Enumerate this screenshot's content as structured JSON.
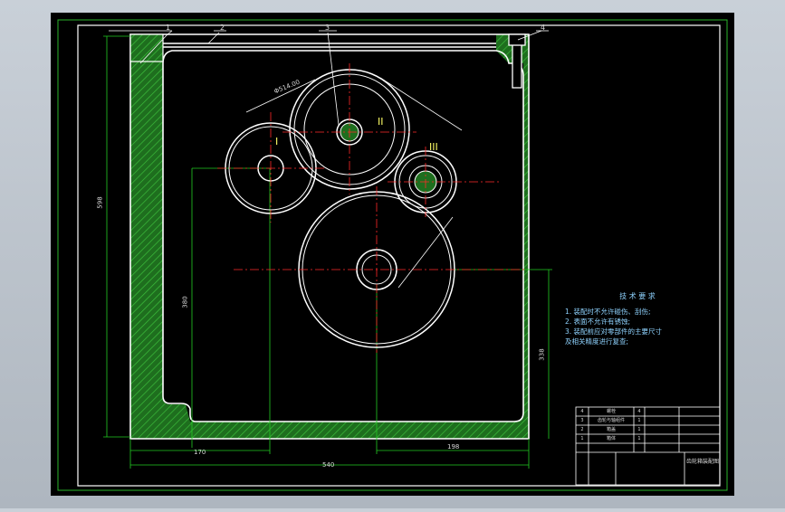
{
  "colors": {
    "background": "#000000",
    "frame": "#2ab52a",
    "outline": "#ffffff",
    "centerline": "#ff2a2a",
    "dimension": "#22cc22",
    "hatch": "#2fa32f",
    "text": "#d8d8d8",
    "note_text": "#8fd3ff",
    "roman_text": "#ffff66",
    "screen": "#c0c7cf"
  },
  "balloons": [
    "1",
    "2",
    "3",
    "4"
  ],
  "gear_labels": [
    "I",
    "II",
    "III"
  ],
  "dimensions": {
    "overall_height": "598",
    "shaft_height": "380",
    "right_height": "338",
    "left_offset": "170",
    "right_offset": "198",
    "overall_width": "540",
    "gear_dia": "Φ514.00"
  },
  "notes": {
    "title": "技 术 要 求",
    "lines": [
      "1. 装配时不允许碰伤、刮伤;",
      "2. 表面不允许有锈蚀;",
      "3. 装配前应对零部件的主要尺寸",
      "及相关精度进行复查;"
    ]
  },
  "title_block": {
    "drawing_name": "齿轮箱装配图",
    "rows": [
      {
        "no": "4",
        "name": "螺栓",
        "qty": "4"
      },
      {
        "no": "3",
        "name": "齿轮与轴组件",
        "qty": "1"
      },
      {
        "no": "2",
        "name": "箱盖",
        "qty": "1"
      },
      {
        "no": "1",
        "name": "箱体",
        "qty": "1"
      }
    ]
  }
}
